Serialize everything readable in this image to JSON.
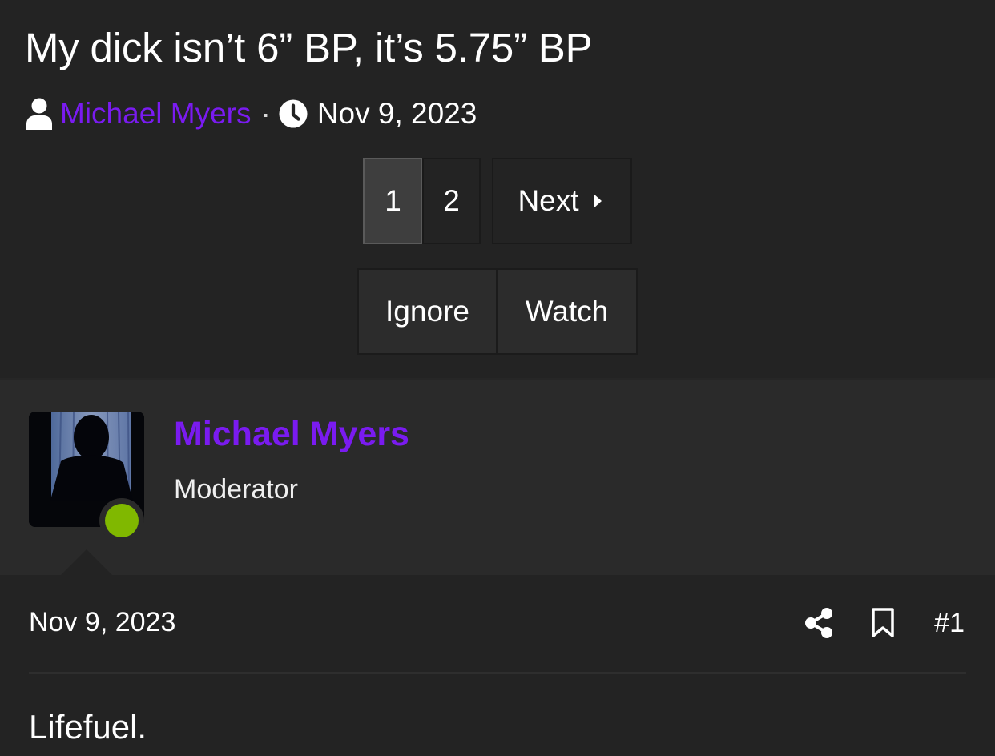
{
  "thread": {
    "title": "My dick isn’t 6” BP, it’s 5.75” BP",
    "author": "Michael Myers",
    "separator": "·",
    "date": "Nov 9, 2023",
    "icons": {
      "author": "user-icon",
      "date": "clock-icon"
    }
  },
  "pagination": {
    "pages": [
      "1",
      "2"
    ],
    "current_page": "1",
    "next_label": "Next",
    "next_icon": "caret-right-icon"
  },
  "thread_actions": {
    "ignore_label": "Ignore",
    "watch_label": "Watch"
  },
  "post": {
    "user": {
      "name": "Michael Myers",
      "title": "Moderator",
      "online": true,
      "online_color": "#80b800"
    },
    "date": "Nov 9, 2023",
    "actions": {
      "share_icon": "share-icon",
      "bookmark_icon": "bookmark-icon",
      "number": "#1"
    },
    "content": "Lifefuel."
  },
  "colors": {
    "background": "#232323",
    "user_block_background": "#2a2a2a",
    "username": "#7a1bf0",
    "active_page": "#3e3e3e",
    "text": "#ffffff"
  }
}
